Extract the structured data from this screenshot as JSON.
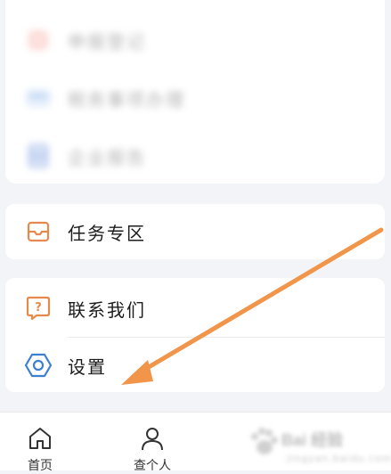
{
  "top_section": {
    "items": [
      {
        "label": "申报登记",
        "icon": "document-red-icon",
        "color": "#f2a39a"
      },
      {
        "label": "税务事项办理",
        "icon": "card-blue-icon",
        "color": "#8fb6ec"
      },
      {
        "label": "企业报告",
        "icon": "report-blue-icon",
        "color": "#6c8fd8"
      }
    ]
  },
  "tasks_section": {
    "label": "任务专区",
    "icon": "inbox-icon",
    "color": "#e58a4c"
  },
  "settings_section": {
    "contact_label": "联系我们",
    "contact_icon": "help-box-icon",
    "settings_label": "设置",
    "settings_icon": "hexagon-gear-icon",
    "contact_color": "#e58a4c",
    "settings_color": "#3d7fd0"
  },
  "bottom_nav": {
    "items": [
      {
        "label": "首页",
        "icon": "home-icon"
      },
      {
        "label": "查个人",
        "icon": "person-icon"
      }
    ]
  },
  "watermark": {
    "text": "Bai 经验",
    "sub": "jingyan.baidu.com"
  },
  "annotation": {
    "arrow_color": "#f0954a"
  }
}
